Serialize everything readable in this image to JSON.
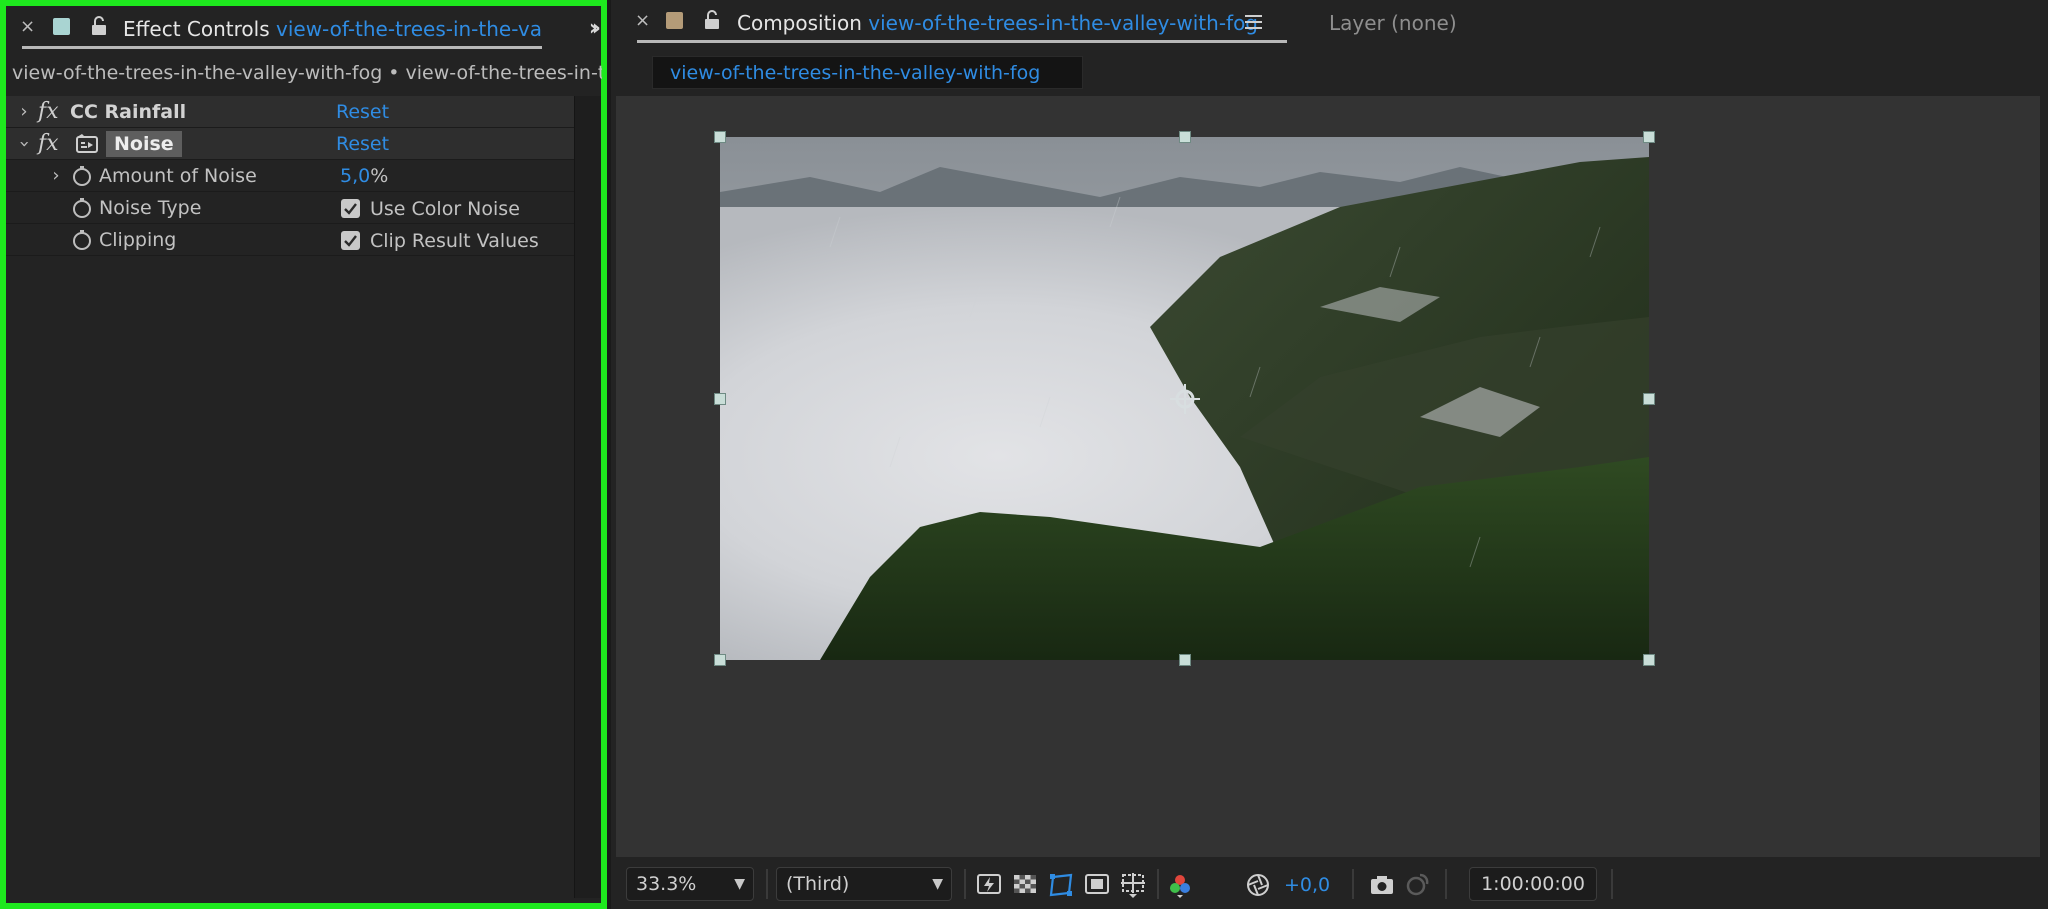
{
  "effect_controls": {
    "tab_label": "Effect Controls",
    "tab_layer": "view-of-the-trees-in-the-valley-with-fog",
    "breadcrumb": "view-of-the-trees-in-the-valley-with-fog • view-of-the-trees-in-the-valley-with-fog",
    "swatch_color": "#a9d4d2",
    "effects": [
      {
        "fx": "fx",
        "name": "CC Rainfall",
        "reset": "Reset",
        "expanded": false
      },
      {
        "fx": "fx",
        "name": "Noise",
        "reset": "Reset",
        "expanded": true
      }
    ],
    "properties": [
      {
        "name": "Amount of Noise",
        "value": "5,0",
        "unit": "%"
      },
      {
        "name": "Noise Type",
        "checkbox_label": "Use Color Noise",
        "checked": true
      },
      {
        "name": "Clipping",
        "checkbox_label": "Clip Result Values",
        "checked": true
      }
    ]
  },
  "composition": {
    "tab_label": "Composition",
    "tab_comp": "view-of-the-trees-in-the-valley-with-fog",
    "swatch_color": "#b49b78",
    "layer_tab": "Layer (none)",
    "subtab": "view-of-the-trees-in-the-valley-with-fog"
  },
  "toolbar": {
    "zoom": "33.3%",
    "resolution": "(Third)",
    "exposure": "+0,0",
    "timecode": "1:00:00:00"
  },
  "colors": {
    "accent_blue": "#2f8ce3",
    "highlight_border": "#1ee81e"
  }
}
